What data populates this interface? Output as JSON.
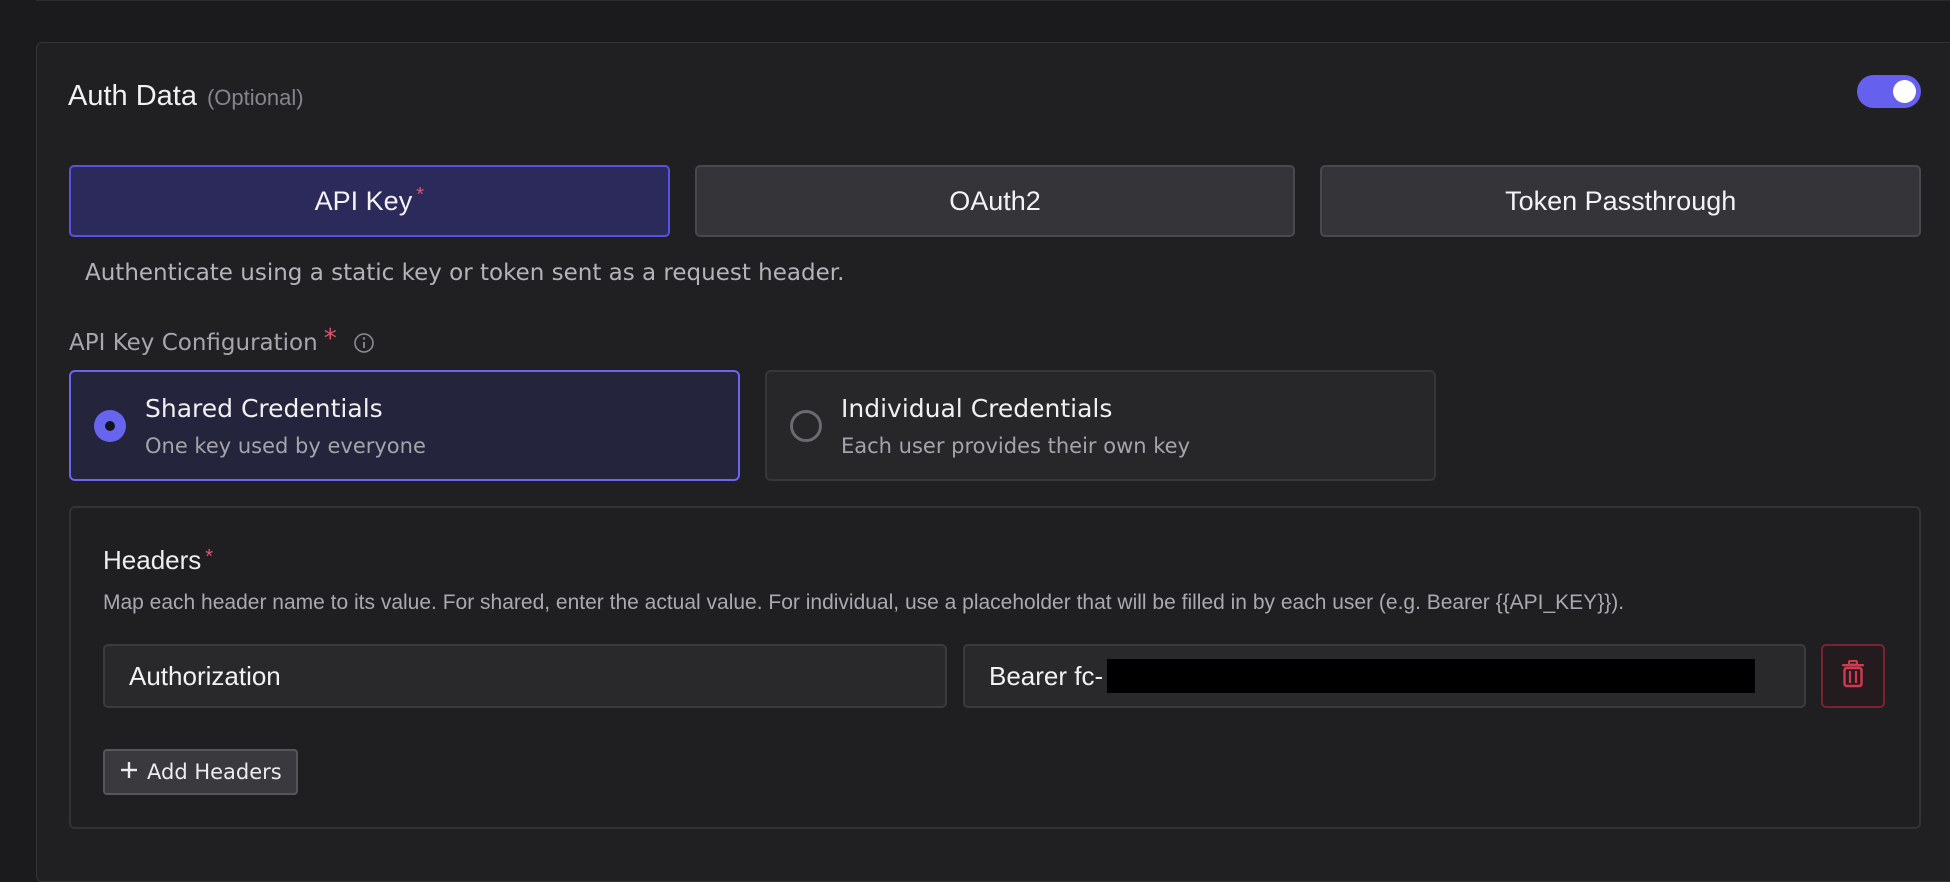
{
  "section": {
    "title": "Auth Data",
    "optional_label": "(Optional)",
    "toggle_enabled": true
  },
  "auth_tabs": [
    {
      "label": "API Key",
      "required": true,
      "active": true
    },
    {
      "label": "OAuth2",
      "active": false
    },
    {
      "label": "Token Passthrough",
      "active": false
    }
  ],
  "description": "Authenticate using a static key or token sent as a request header.",
  "config": {
    "label": "API Key Configuration",
    "required_mark": "*",
    "options": [
      {
        "title": "Shared Credentials",
        "subtitle": "One key used by everyone",
        "selected": true
      },
      {
        "title": "Individual Credentials",
        "subtitle": "Each user provides their own key",
        "selected": false
      }
    ]
  },
  "headers": {
    "title": "Headers",
    "required_mark": "*",
    "help": "Map each header name to its value. For shared, enter the actual value. For individual, use a placeholder that will be filled in by each user (e.g. Bearer {{API_KEY}}).",
    "rows": [
      {
        "name": "Authorization",
        "value_visible": "Bearer fc-",
        "value_redacted": true
      }
    ],
    "add_label": "Add Headers"
  },
  "colors": {
    "accent": "#6561ee",
    "required": "#e05470",
    "danger": "#d2394f"
  },
  "icons": {
    "info": "info-circle-icon",
    "delete": "trash-icon",
    "add": "plus-icon"
  }
}
